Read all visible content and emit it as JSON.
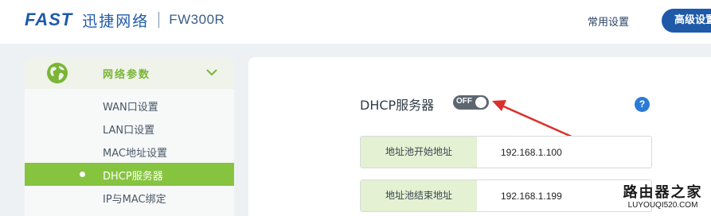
{
  "header": {
    "logo": "FAST",
    "brand_cn": "迅捷网络",
    "model": "FW300R",
    "common_settings": "常用设置",
    "advanced_settings": "高级设置"
  },
  "sidebar": {
    "section_label": "网络参数",
    "items": [
      {
        "label": "WAN口设置",
        "active": false
      },
      {
        "label": "LAN口设置",
        "active": false
      },
      {
        "label": "MAC地址设置",
        "active": false
      },
      {
        "label": "DHCP服务器",
        "active": true
      },
      {
        "label": "IP与MAC绑定",
        "active": false
      }
    ]
  },
  "main": {
    "title": "DHCP服务器",
    "toggle_state": "OFF",
    "help": "?",
    "fields": [
      {
        "label": "地址池开始地址",
        "value": "192.168.1.100"
      },
      {
        "label": "地址池结束地址",
        "value": "192.168.1.199"
      }
    ]
  },
  "watermark": {
    "cn": "路由器之家",
    "url": "LUYOUQI520.COM"
  },
  "colors": {
    "brand_blue": "#1e5aa8",
    "accent_green": "#86c440",
    "arrow_red": "#d9302b"
  }
}
